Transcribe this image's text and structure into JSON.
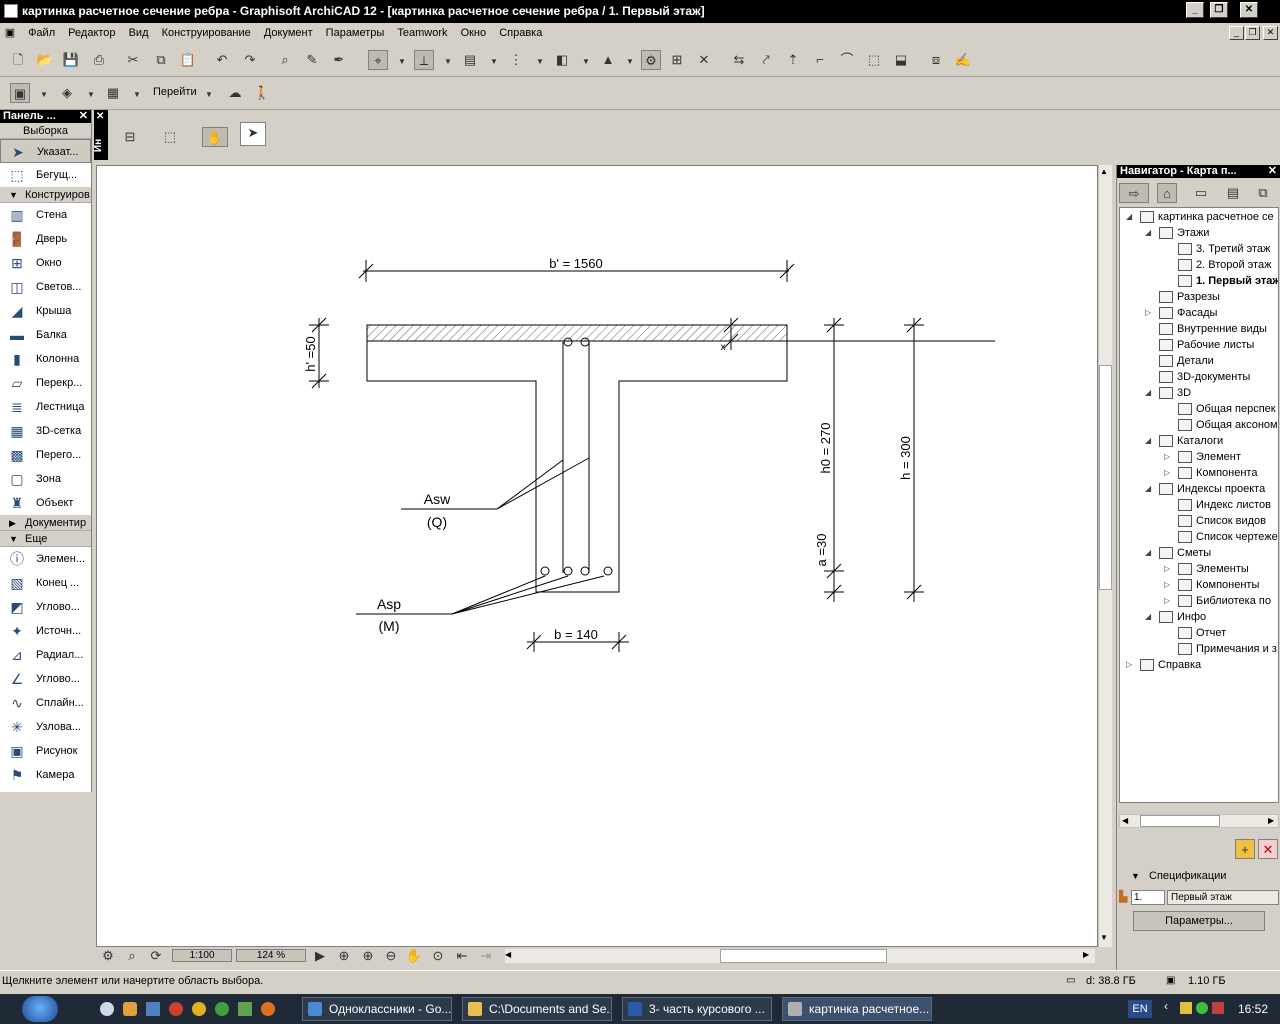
{
  "window": {
    "title": "картинка расчетное сечение ребра  - Graphisoft ArchiCAD 12 - [картинка расчетное сечение ребра  / 1. Первый этаж]"
  },
  "menu": [
    "Файл",
    "Редактор",
    "Вид",
    "Конструирование",
    "Документ",
    "Параметры",
    "Teamwork",
    "Окно",
    "Справка"
  ],
  "toolbar2": {
    "goto_label": "Перейти"
  },
  "toolbox": {
    "title": "Панель ...",
    "selection_header": "Выборка",
    "select_tools": [
      {
        "label": "Указат...",
        "icon": "arrow-pointer-icon"
      },
      {
        "label": "Бегущ...",
        "icon": "marquee-icon"
      }
    ],
    "design_header": "Конструиров",
    "design_tools": [
      {
        "label": "Стена",
        "icon": "wall-icon"
      },
      {
        "label": "Дверь",
        "icon": "door-icon"
      },
      {
        "label": "Окно",
        "icon": "window-icon"
      },
      {
        "label": "Светов...",
        "icon": "skylight-icon"
      },
      {
        "label": "Крыша",
        "icon": "roof-icon"
      },
      {
        "label": "Балка",
        "icon": "beam-icon"
      },
      {
        "label": "Колонна",
        "icon": "column-icon"
      },
      {
        "label": "Перекр...",
        "icon": "slab-icon"
      },
      {
        "label": "Лестница",
        "icon": "stair-icon"
      },
      {
        "label": "3D-сетка",
        "icon": "mesh-icon"
      },
      {
        "label": "Перего...",
        "icon": "curtain-wall-icon"
      },
      {
        "label": "Зона",
        "icon": "zone-icon"
      },
      {
        "label": "Объект",
        "icon": "object-icon"
      }
    ],
    "document_header": "Документир",
    "more_header": "Еще",
    "more_tools": [
      {
        "label": "Элемен...",
        "icon": "element-icon"
      },
      {
        "label": "Конец ...",
        "icon": "wall-end-icon"
      },
      {
        "label": "Углово...",
        "icon": "corner-window-icon"
      },
      {
        "label": "Источн...",
        "icon": "lamp-icon"
      },
      {
        "label": "Радиал...",
        "icon": "radial-dimension-icon"
      },
      {
        "label": "Углово...",
        "icon": "angle-dimension-icon"
      },
      {
        "label": "Сплайн...",
        "icon": "spline-icon"
      },
      {
        "label": "Узлова...",
        "icon": "hotspot-icon"
      },
      {
        "label": "Рисунок",
        "icon": "picture-icon"
      },
      {
        "label": "Камера",
        "icon": "camera-icon"
      }
    ]
  },
  "infobox": {
    "label": "Ин"
  },
  "drawing": {
    "dim_top": "b' = 1560",
    "dim_flange": "h' =50",
    "dim_web": "b = 140",
    "dim_h0": "h0 = 270",
    "dim_a": "a =30",
    "dim_h": "h = 300",
    "label_asw": "Asw",
    "label_q": "(Q)",
    "label_asp": "Asp",
    "label_m": "(M)",
    "mark_x": "x"
  },
  "bottombar": {
    "scale": "1:100",
    "zoom": "124 %"
  },
  "status": {
    "hint": "Щелкните элемент или начертите область выбора.",
    "disk": "d: 38.8 ГБ",
    "memory": "1.10 ГБ"
  },
  "navigator": {
    "title": "Навигатор - Карта п...",
    "tree": [
      {
        "label": "картинка расчетное се",
        "level": 0,
        "toggle": "open",
        "icon": "project-icon"
      },
      {
        "label": "Этажи",
        "level": 1,
        "toggle": "open",
        "icon": "stories-icon"
      },
      {
        "label": "3. Третий этаж",
        "level": 2,
        "toggle": "",
        "icon": "story-icon"
      },
      {
        "label": "2. Второй этаж",
        "level": 2,
        "toggle": "",
        "icon": "story-icon"
      },
      {
        "label": "1. Первый этаж",
        "level": 2,
        "toggle": "",
        "icon": "story-icon",
        "bold": true
      },
      {
        "label": "Разрезы",
        "level": 1,
        "toggle": "",
        "icon": "section-icon"
      },
      {
        "label": "Фасады",
        "level": 1,
        "toggle": "closed",
        "icon": "elevation-icon"
      },
      {
        "label": "Внутренние виды",
        "level": 1,
        "toggle": "",
        "icon": "interior-elevation-icon"
      },
      {
        "label": "Рабочие листы",
        "level": 1,
        "toggle": "",
        "icon": "worksheet-icon"
      },
      {
        "label": "Детали",
        "level": 1,
        "toggle": "",
        "icon": "detail-icon"
      },
      {
        "label": "3D-документы",
        "level": 1,
        "toggle": "",
        "icon": "3d-document-icon"
      },
      {
        "label": "3D",
        "level": 1,
        "toggle": "open",
        "icon": "3d-icon"
      },
      {
        "label": "Общая перспек",
        "level": 2,
        "toggle": "",
        "icon": "perspective-icon"
      },
      {
        "label": "Общая аксоном",
        "level": 2,
        "toggle": "",
        "icon": "axonometry-icon"
      },
      {
        "label": "Каталоги",
        "level": 1,
        "toggle": "open",
        "icon": "schedule-icon"
      },
      {
        "label": "Элемент",
        "level": 2,
        "toggle": "closed",
        "icon": "element-schedule-icon"
      },
      {
        "label": "Компонента",
        "level": 2,
        "toggle": "closed",
        "icon": "component-schedule-icon"
      },
      {
        "label": "Индексы проекта",
        "level": 1,
        "toggle": "open",
        "icon": "project-index-icon"
      },
      {
        "label": "Индекс листов",
        "level": 2,
        "toggle": "",
        "icon": "sheet-index-icon"
      },
      {
        "label": "Список видов",
        "level": 2,
        "toggle": "",
        "icon": "view-list-icon"
      },
      {
        "label": "Список чертеже",
        "level": 2,
        "toggle": "",
        "icon": "drawing-list-icon"
      },
      {
        "label": "Сметы",
        "level": 1,
        "toggle": "open",
        "icon": "estimate-icon"
      },
      {
        "label": "Элементы",
        "level": 2,
        "toggle": "closed",
        "icon": "elements-list-icon"
      },
      {
        "label": "Компоненты",
        "level": 2,
        "toggle": "closed",
        "icon": "components-list-icon"
      },
      {
        "label": "Библиотека по",
        "level": 2,
        "toggle": "closed",
        "icon": "library-icon"
      },
      {
        "label": "Инфо",
        "level": 1,
        "toggle": "open",
        "icon": "info-icon"
      },
      {
        "label": "Отчет",
        "level": 2,
        "toggle": "",
        "icon": "report-icon"
      },
      {
        "label": "Примечания и з",
        "level": 2,
        "toggle": "",
        "icon": "notes-icon"
      },
      {
        "label": "Справка",
        "level": 0,
        "toggle": "closed",
        "icon": "help-icon"
      }
    ],
    "specs_label": "Спецификации",
    "story_num": "1.",
    "story_name": "Первый этаж",
    "params_button": "Параметры..."
  },
  "taskbar": {
    "tasks": [
      {
        "label": "Одноклассники - Go...",
        "color": "#4a8ad4"
      },
      {
        "label": "C:\\Documents and Se...",
        "color": "#e8c050"
      },
      {
        "label": "3- часть курсового ...",
        "color": "#2a5aa8"
      },
      {
        "label": "картинка расчетное...",
        "color": "#b0b0b0"
      }
    ],
    "lang": "EN",
    "clock": "16:52"
  },
  "colors": {
    "title_bg": "#000000",
    "chrome": "#d4d0c8",
    "taskbar": "#1f2a36"
  }
}
